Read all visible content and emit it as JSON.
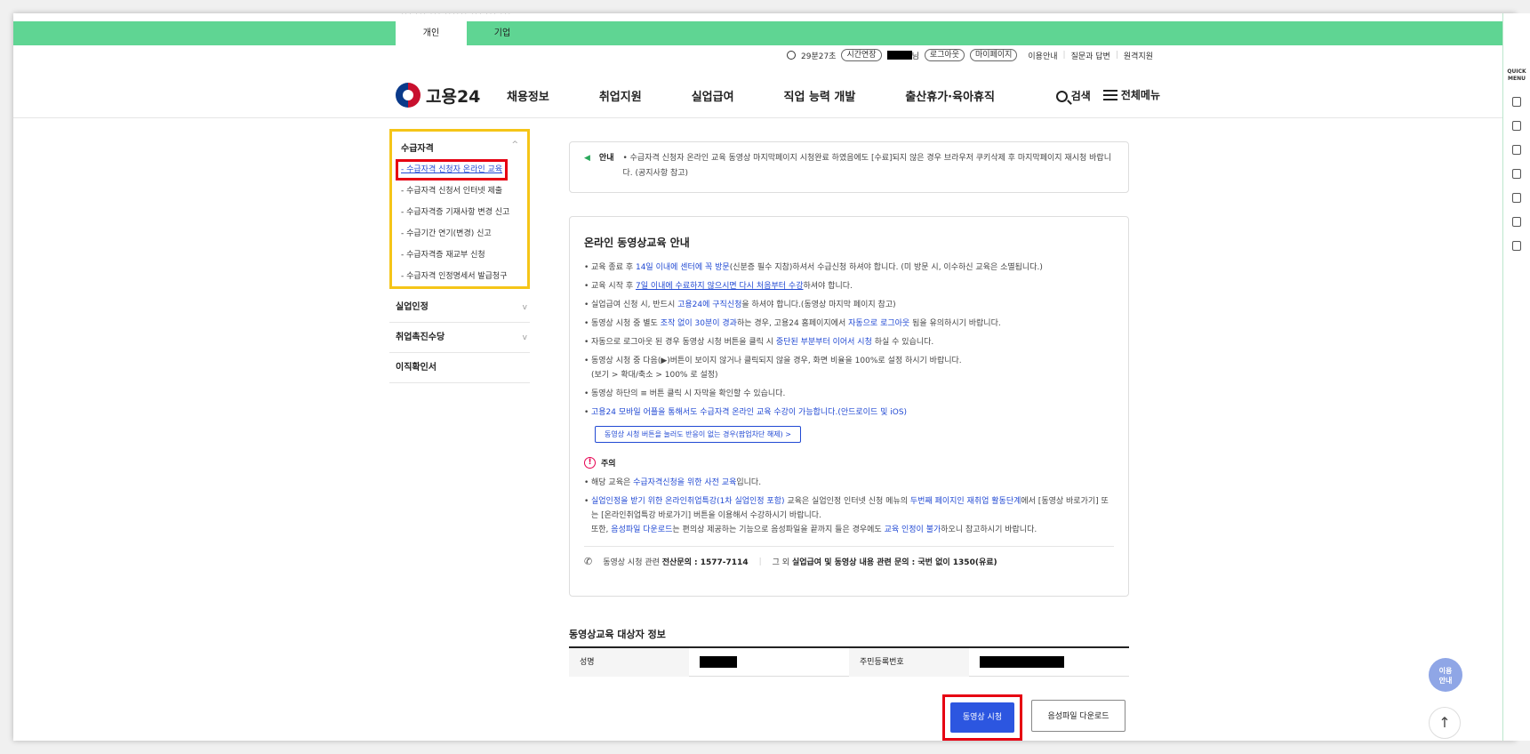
{
  "top_strip": "*** *** *** ****** *** *** ***",
  "user_type_tabs": [
    "개인",
    "기업"
  ],
  "utility": {
    "timer": "29분27초",
    "extend": "시간연장",
    "user_suffix": "님",
    "logout": "로그아웃",
    "mypage": "마이페이지",
    "links": [
      "이용안내",
      "질문과 답변",
      "원격지원"
    ]
  },
  "header": {
    "logo_text": "고용24",
    "nav": [
      "채용정보",
      "취업지원",
      "실업급여",
      "직업 능력 개발",
      "출산휴가·육아휴직"
    ],
    "search": "검색",
    "all_menu": "전체메뉴"
  },
  "sidebar": {
    "section_title": "수급자격",
    "sub_items": [
      "- 수급자격 신청자 온라인 교육",
      "- 수급자격 신청서 인터넷 제출",
      "- 수급자격증 기재사항 변경 신고",
      "- 수급기간 연기(변경) 신고",
      "- 수급자격증 재교부 신청",
      "- 수급자격 인정명세서 발급청구"
    ],
    "groups": [
      "실업인정",
      "취업촉진수당",
      "이직확인서"
    ]
  },
  "notice": {
    "label": "안내",
    "text": "• 수급자격 신청자 온라인 교육 동영상 마지막페이지 시청완료 하였음에도 [수료]되지 않은 경우 브라우저 쿠키삭제 후 마지막페이지 재시청 바랍니다. (공지사항 참고)"
  },
  "guide": {
    "title": "온라인 동영상교육 안내",
    "items": [
      [
        "교육 종료 후 ",
        "14일 이내에 센터에 꼭 방문",
        "(신분증 필수 지참)하셔서 수급신청 하셔야 합니다. (미 방문 시, 이수하신 교육은 소멸됩니다.)"
      ],
      [
        "교육 시작 후 ",
        "7일 이내에 수료하지 않으시면 다시 처음부터 수강",
        "하셔야 합니다."
      ],
      [
        "실업급여 신청 시, 반드시 ",
        "고용24에 구직신청",
        "을 하셔야 합니다.(동영상 마지막 페이지 참고)"
      ],
      [
        "동영상 시청 중 별도 ",
        "조작 없이 30분이 경과",
        "하는 경우, 고용24 홈페이지에서 ",
        "자동으로 로그아웃",
        " 됨을 유의하시기 바랍니다."
      ],
      [
        "자동으로 로그아웃 된 경우 동영상 시청 버튼을 클릭 시 ",
        "중단된 부분부터 이어서 시청",
        " 하실 수 있습니다."
      ],
      [
        "동영상 시청 중 다음(▶)버튼이 보이지 않거나 클릭되지 않을 경우, 화면 비율을 100%로 설정 하시기 바랍니다.",
        "(보기 > 확대/축소 > 100% 로 설정)"
      ],
      [
        "동영상 하단의 ≡ 버튼 클릭 시 자막을 확인할 수 있습니다."
      ],
      [
        "고용24 모바일 어플을 통해서도 수급자격 온라인 교육 수강이 가능합니다.(안드로이드 및 iOS)"
      ]
    ],
    "popup_button": "동영상 시청 버튼을 눌러도 반응이 없는 경우(팝업차단 해제)  >",
    "caution_title": "주의",
    "caution_items": [
      [
        "해당 교육은 ",
        "수급자격신청을 위한 사전 교육",
        "입니다."
      ],
      [
        "실업인정을 받기 위한 온라인취업특강(1차 실업인정 포함)",
        " 교육은 실업인정 인터넷 신청 메뉴의 ",
        "두번째 페이지인 재취업 활동단계",
        "에서 [동영상 바로가기] 또는 [온라인취업특강 바로가기] 버튼을 이용해서 수강하시기 바랍니다.",
        "또한, ",
        "음성파일 다운로드",
        "는 편의상 제공하는 기능으로 음성파일을 끝까지 들은 경우에도 ",
        "교육 인정이 불가",
        "하오니 참고하시기 바랍니다."
      ]
    ],
    "contact1_label": "동영상 시청 관련 ",
    "contact1_bold": "전산문의 : 1577-7114",
    "contact2_label": "그 외 ",
    "contact2_bold": "실업급여 및 동영상 내용 관련 문의 : 국번 없이 1350(유료)"
  },
  "target_info": {
    "title": "동영상교육 대상자 정보",
    "name_label": "성명",
    "rrn_label": "주민등록번호"
  },
  "buttons": {
    "watch": "동영상 시청",
    "audio": "음성파일 다운로드"
  },
  "fab": {
    "guide": "이용\n안내",
    "top": "↑"
  },
  "quick_menu": "QUICK MENU"
}
